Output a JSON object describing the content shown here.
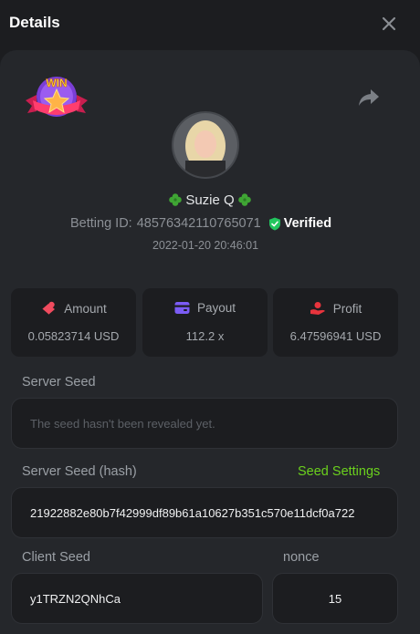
{
  "header": {
    "title": "Details"
  },
  "profile": {
    "username": "Suzie Q",
    "betting_id_label": "Betting ID:",
    "betting_id": "48576342110765071",
    "verified_label": "Verified",
    "timestamp": "2022-01-20 20:46:01",
    "badge_text": "WIN"
  },
  "stats": {
    "amount": {
      "label": "Amount",
      "value": "0.05823714 USD",
      "icon": "bet-chip-icon"
    },
    "payout": {
      "label": "Payout",
      "value": "112.2 x",
      "icon": "wallet-card-icon"
    },
    "profit": {
      "label": "Profit",
      "value": "6.47596941 USD",
      "icon": "profit-hand-icon"
    }
  },
  "server_seed": {
    "label": "Server Seed",
    "placeholder": "The seed hasn't been revealed yet."
  },
  "server_seed_hash": {
    "label": "Server Seed (hash)",
    "settings_link": "Seed Settings",
    "value": "21922882e80b7f42999df89b61a10627b351c570e11dcf0a722"
  },
  "client_seed": {
    "label": "Client Seed",
    "value": "y1TRZN2QNhCa"
  },
  "nonce": {
    "label": "nonce",
    "value": "15"
  },
  "colors": {
    "background": "#1c1d20",
    "panel": "#25272b",
    "accent_green": "#6bd11d",
    "verified_green": "#22c55e",
    "amount_icon": "#f04b5e",
    "payout_icon": "#7b5cf5",
    "profit_icon": "#e8343d"
  }
}
